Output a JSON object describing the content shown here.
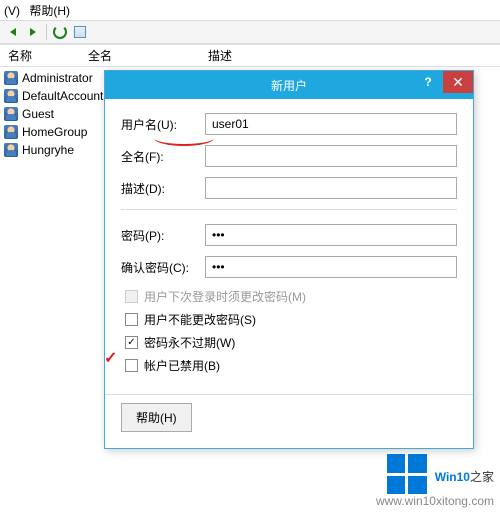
{
  "menubar": {
    "view": "(V)",
    "help": "帮助(H)"
  },
  "columns": {
    "name": "名称",
    "fullname": "全名",
    "desc": "描述"
  },
  "users": [
    {
      "name": "Administrator"
    },
    {
      "name": "DefaultAccount"
    },
    {
      "name": "Guest"
    },
    {
      "name": "HomeGroup"
    },
    {
      "name": "Hungryhe"
    }
  ],
  "dialog": {
    "title": "新用户",
    "help_q": "?",
    "close_x": "✕",
    "labels": {
      "username": "用户名(U):",
      "fullname": "全名(F):",
      "desc": "描述(D):",
      "password": "密码(P):",
      "confirm": "确认密码(C):"
    },
    "values": {
      "username": "user01",
      "fullname": "",
      "desc": "",
      "password": "•••",
      "confirm": "•••"
    },
    "checks": {
      "mustchange": "用户下次登录时须更改密码(M)",
      "cannotchange": "用户不能更改密码(S)",
      "neverexpire": "密码永不过期(W)",
      "disabled": "帐户已禁用(B)"
    },
    "buttons": {
      "help": "帮助(H)"
    }
  },
  "watermark": {
    "brand_a": "Win10",
    "brand_b": "之家",
    "url": "www.win10xitong.com"
  }
}
